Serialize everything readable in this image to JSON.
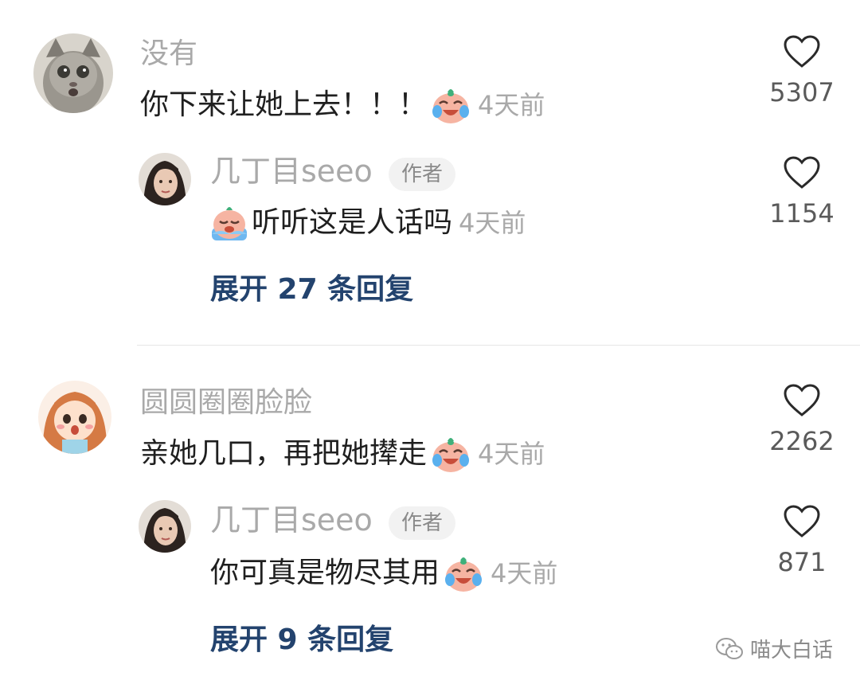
{
  "threads": [
    {
      "comment": {
        "username": "没有",
        "text": "你下来让她上去！！！",
        "emoji": "laughing-crying-emoji",
        "time": "4天前",
        "likes": "5307"
      },
      "reply": {
        "username": "几丁目seeo",
        "author_badge": "作者",
        "emoji": "crying-emoji",
        "text": "听听这是人话吗",
        "time": "4天前",
        "likes": "1154"
      },
      "expand_label": "展开 27 条回复"
    },
    {
      "comment": {
        "username": "圆圆圈圈脸脸",
        "text": "亲她几口，再把她撵走",
        "emoji": "laughing-crying-emoji",
        "time": "4天前",
        "likes": "2262"
      },
      "reply": {
        "username": "几丁目seeo",
        "author_badge": "作者",
        "text": "你可真是物尽其用",
        "emoji": "laughing-crying-emoji",
        "time": "4天前",
        "likes": "871"
      },
      "expand_label": "展开 9 条回复"
    }
  ],
  "watermark": {
    "icon": "wechat-icon",
    "text": "喵大白话"
  },
  "colors": {
    "username": "#a9a9a9",
    "text": "#1f1f1f",
    "expand": "#23436e"
  }
}
